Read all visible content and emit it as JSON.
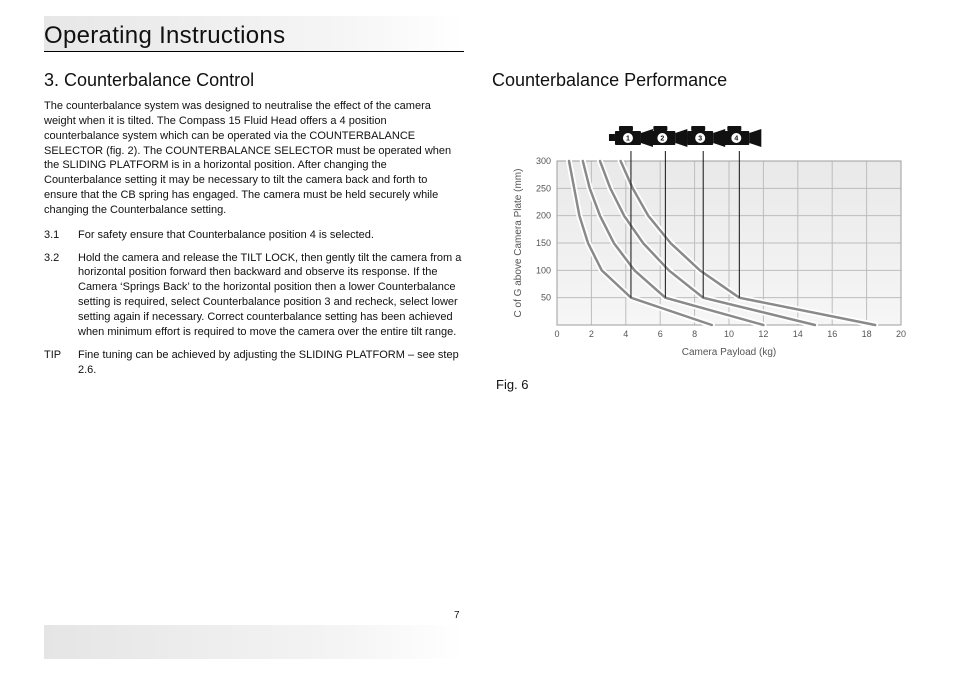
{
  "header": {
    "title": "Operating Instructions"
  },
  "left": {
    "section_title": "3.  Counterbalance Control",
    "intro": "The counterbalance system was designed to neutralise the effect of the camera weight when it is tilted. The Compass 15 Fluid Head offers a 4 position counterbalance system which can be operated via the COUNTERBALANCE SELECTOR (fig. 2). The COUNTERBALANCE SELECTOR must be operated when the SLIDING PLATFORM is in a horizontal position. After changing the Counterbalance setting it may be necessary to tilt the camera back and forth to ensure that the CB spring has engaged. The camera must be held securely while changing the Counterbalance setting.",
    "steps": [
      {
        "num": "3.1",
        "text": "For safety ensure that Counterbalance position 4 is selected."
      },
      {
        "num": "3.2",
        "text": "Hold the camera and release the TILT LOCK, then gently tilt the camera from a horizontal position forward then backward and observe its response. If the Camera ‘Springs Back’ to the horizontal position then a lower Counterbalance setting is required, select Counterbalance position 3 and recheck, select lower setting again if necessary. Correct counterbalance setting has been achieved when minimum effort is required to move the camera over the entire tilt range."
      },
      {
        "num": "TIP",
        "text": "Fine tuning can be achieved by adjusting the SLIDING PLATFORM – see step 2.6."
      }
    ]
  },
  "right": {
    "section_title": "Counterbalance Performance",
    "figure_caption": "Fig. 6"
  },
  "page_number": "7",
  "chart_data": {
    "type": "line",
    "title": "Counterbalance Performance",
    "xlabel": "Camera Payload (kg)",
    "ylabel": "C of G above Camera Plate (mm)",
    "xlim": [
      0,
      20
    ],
    "ylim": [
      0,
      300
    ],
    "x_ticks": [
      0,
      2,
      4,
      6,
      8,
      10,
      12,
      14,
      16,
      18,
      20
    ],
    "y_ticks": [
      50,
      100,
      150,
      200,
      250,
      300
    ],
    "legend_markers": [
      {
        "name": "1",
        "x_pointer": 4.3
      },
      {
        "name": "2",
        "x_pointer": 6.3
      },
      {
        "name": "3",
        "x_pointer": 8.5
      },
      {
        "name": "4",
        "x_pointer": 10.6
      }
    ],
    "series": [
      {
        "name": "1",
        "points": [
          {
            "x": 0.7,
            "y": 300
          },
          {
            "x": 1.0,
            "y": 250
          },
          {
            "x": 1.3,
            "y": 200
          },
          {
            "x": 1.8,
            "y": 150
          },
          {
            "x": 2.6,
            "y": 100
          },
          {
            "x": 4.3,
            "y": 50
          },
          {
            "x": 9.0,
            "y": 0
          }
        ]
      },
      {
        "name": "2",
        "points": [
          {
            "x": 1.5,
            "y": 300
          },
          {
            "x": 1.9,
            "y": 250
          },
          {
            "x": 2.5,
            "y": 200
          },
          {
            "x": 3.3,
            "y": 150
          },
          {
            "x": 4.5,
            "y": 100
          },
          {
            "x": 6.3,
            "y": 50
          },
          {
            "x": 12.0,
            "y": 0
          }
        ]
      },
      {
        "name": "3",
        "points": [
          {
            "x": 2.5,
            "y": 300
          },
          {
            "x": 3.1,
            "y": 250
          },
          {
            "x": 3.9,
            "y": 200
          },
          {
            "x": 5.0,
            "y": 150
          },
          {
            "x": 6.5,
            "y": 100
          },
          {
            "x": 8.5,
            "y": 50
          },
          {
            "x": 15.0,
            "y": 0
          }
        ]
      },
      {
        "name": "4",
        "points": [
          {
            "x": 3.7,
            "y": 300
          },
          {
            "x": 4.4,
            "y": 250
          },
          {
            "x": 5.3,
            "y": 200
          },
          {
            "x": 6.6,
            "y": 150
          },
          {
            "x": 8.3,
            "y": 100
          },
          {
            "x": 10.6,
            "y": 50
          },
          {
            "x": 18.5,
            "y": 0
          }
        ]
      }
    ]
  }
}
